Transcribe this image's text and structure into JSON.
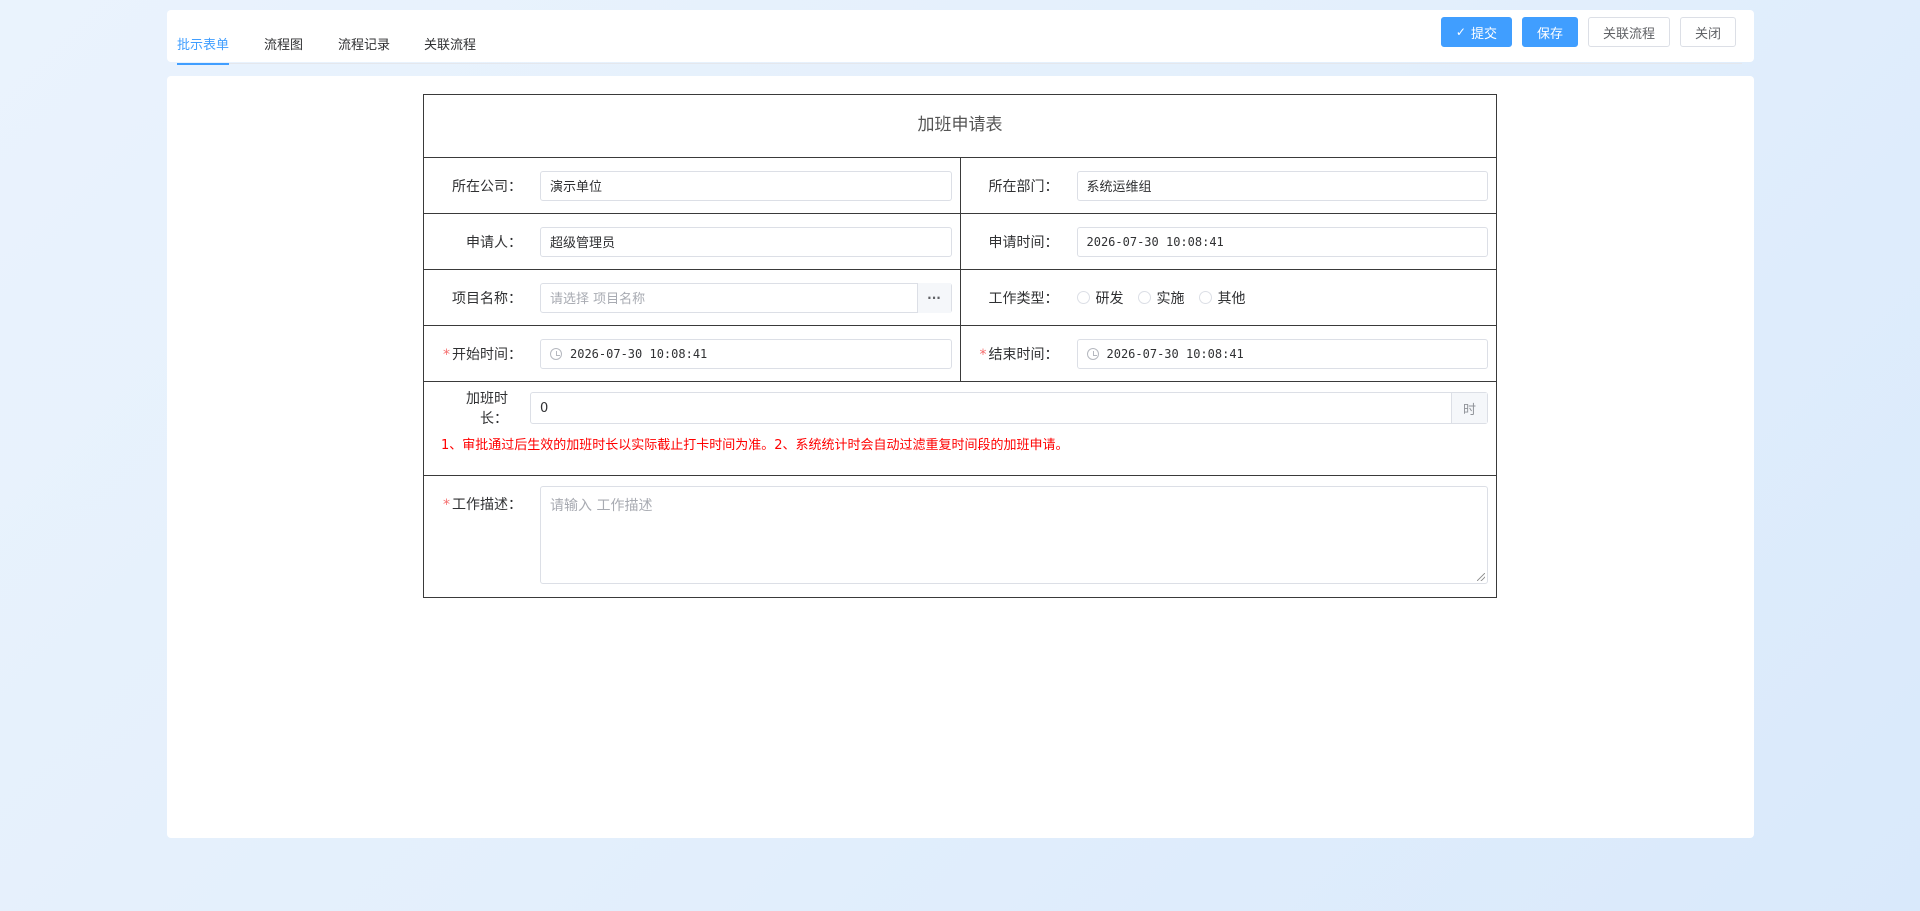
{
  "tabs": [
    {
      "label": "批示表单",
      "active": true
    },
    {
      "label": "流程图",
      "active": false
    },
    {
      "label": "流程记录",
      "active": false
    },
    {
      "label": "关联流程",
      "active": false
    }
  ],
  "actions": {
    "submit": "提交",
    "save": "保存",
    "link": "关联流程",
    "close": "关闭"
  },
  "form": {
    "title": "加班申请表",
    "company_label": "所在公司：",
    "company_value": "演示单位",
    "dept_label": "所在部门：",
    "dept_value": "系统运维组",
    "applicant_label": "申请人：",
    "applicant_value": "超级管理员",
    "apply_time_label": "申请时间：",
    "apply_time_value": "2026-07-30 10:08:41",
    "project_label": "项目名称：",
    "project_placeholder": "请选择 项目名称",
    "project_button": "···",
    "work_type_label": "工作类型：",
    "work_types": [
      "研发",
      "实施",
      "其他"
    ],
    "start_label": "开始时间：",
    "start_value": "2026-07-30 10:08:41",
    "end_label": "结束时间：",
    "end_value": "2026-07-30 10:08:41",
    "duration_label": "加班时长：",
    "duration_value": "0",
    "duration_unit": "时",
    "note": "1、审批通过后生效的加班时长以实际截止打卡时间为准。2、系统统计时会自动过滤重复时间段的加班申请。",
    "desc_label": "工作描述：",
    "desc_placeholder": "请输入 工作描述",
    "required_mark": "*"
  },
  "colors": {
    "accent": "#409eff",
    "required": "#f56c6c",
    "note": "#ff0000"
  }
}
